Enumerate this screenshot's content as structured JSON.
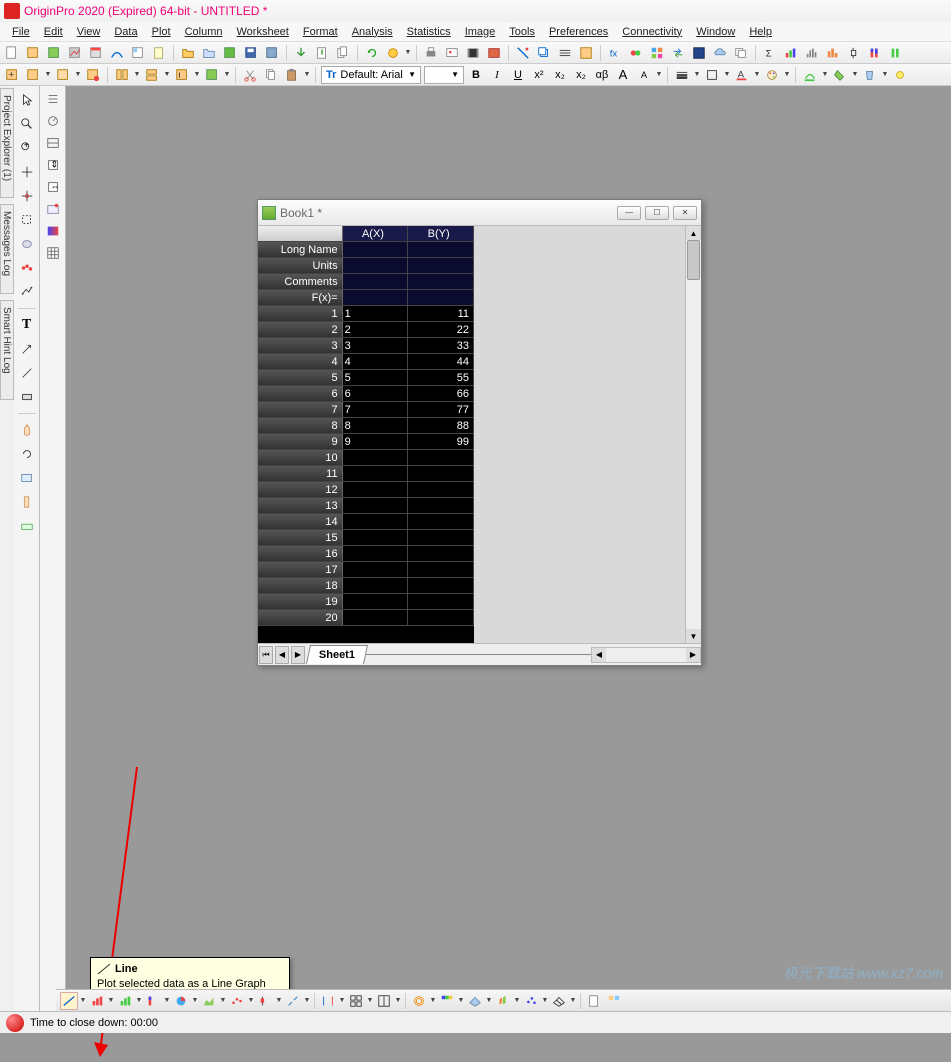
{
  "app": {
    "title": "OriginPro 2020 (Expired) 64-bit - UNTITLED *"
  },
  "menu": [
    "File",
    "Edit",
    "View",
    "Data",
    "Plot",
    "Column",
    "Worksheet",
    "Format",
    "Analysis",
    "Statistics",
    "Image",
    "Tools",
    "Preferences",
    "Connectivity",
    "Window",
    "Help"
  ],
  "side_tabs": {
    "project_explorer": "Project Explorer (1)",
    "messages_log": "Messages Log",
    "smart_hint_log": "Smart Hint Log"
  },
  "font": {
    "selector_prefix": "Tr",
    "name": "Default: Arial",
    "size": ""
  },
  "format_buttons": {
    "bold": "B",
    "italic": "I",
    "underline": "U",
    "sup": "x²",
    "sub": "x₂",
    "supsub": "x₂",
    "alpha": "αβ",
    "Abig": "A",
    "Asmall": "A"
  },
  "book": {
    "title": "Book1 *",
    "columns": [
      "A(X)",
      "B(Y)"
    ],
    "meta_rows": [
      "Long Name",
      "Units",
      "Comments",
      "F(x)="
    ],
    "data": [
      {
        "n": 1,
        "a": "1",
        "b": "11"
      },
      {
        "n": 2,
        "a": "2",
        "b": "22"
      },
      {
        "n": 3,
        "a": "3",
        "b": "33"
      },
      {
        "n": 4,
        "a": "4",
        "b": "44"
      },
      {
        "n": 5,
        "a": "5",
        "b": "55"
      },
      {
        "n": 6,
        "a": "6",
        "b": "66"
      },
      {
        "n": 7,
        "a": "7",
        "b": "77"
      },
      {
        "n": 8,
        "a": "8",
        "b": "88"
      },
      {
        "n": 9,
        "a": "9",
        "b": "99"
      },
      {
        "n": 10,
        "a": "",
        "b": ""
      },
      {
        "n": 11,
        "a": "",
        "b": ""
      },
      {
        "n": 12,
        "a": "",
        "b": ""
      },
      {
        "n": 13,
        "a": "",
        "b": ""
      },
      {
        "n": 14,
        "a": "",
        "b": ""
      },
      {
        "n": 15,
        "a": "",
        "b": ""
      },
      {
        "n": 16,
        "a": "",
        "b": ""
      },
      {
        "n": 17,
        "a": "",
        "b": ""
      },
      {
        "n": 18,
        "a": "",
        "b": ""
      },
      {
        "n": 19,
        "a": "",
        "b": ""
      },
      {
        "n": 20,
        "a": "",
        "b": ""
      }
    ],
    "sheet_tab": "Sheet1"
  },
  "tooltip": {
    "title": "Line",
    "desc": "Plot selected data as a Line Graph"
  },
  "status": {
    "text": "Time to close down: 00:00"
  },
  "watermark": "极光下载站 www.xz7.com"
}
